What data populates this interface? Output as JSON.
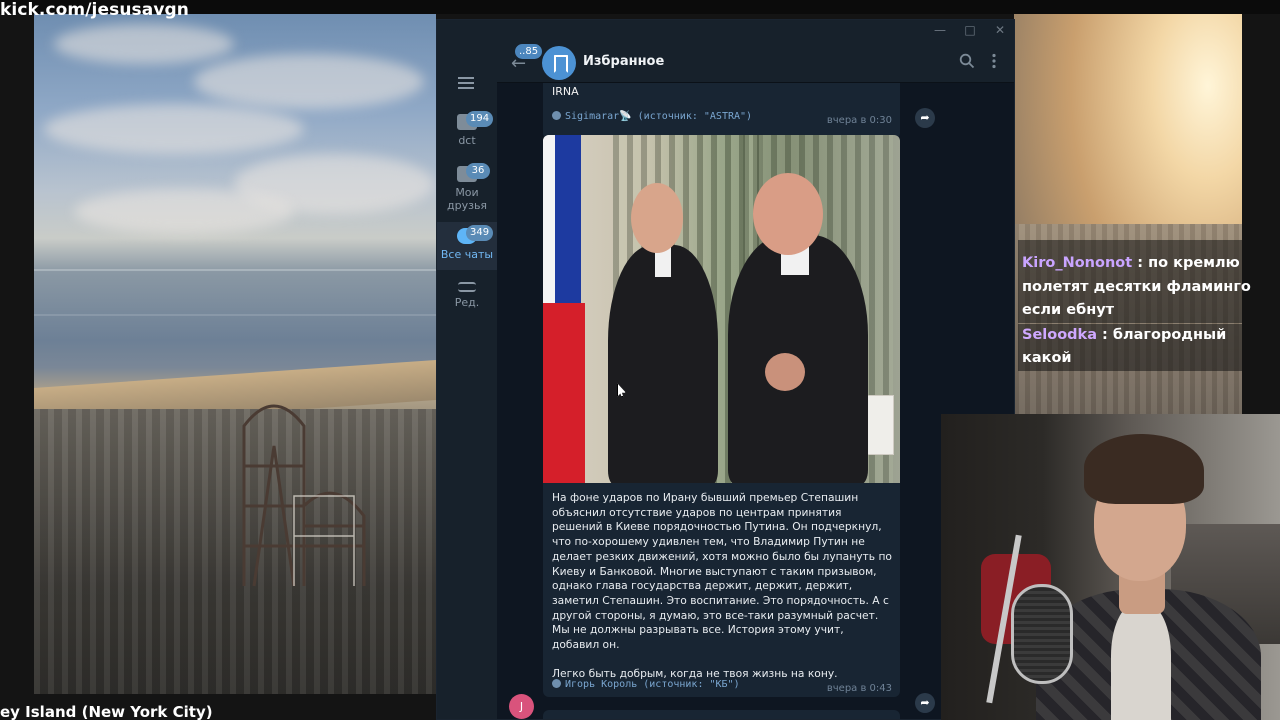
{
  "stream": {
    "url": "kick.com/jesusavgn",
    "background_caption": "ey Island (New York City)"
  },
  "window": {
    "controls": [
      "—",
      "□",
      "✕"
    ]
  },
  "folders": [
    {
      "label": "dct",
      "badge": "194",
      "active": false
    },
    {
      "label": "Мои друзья",
      "badge": "36",
      "active": false
    },
    {
      "label": "Все чаты",
      "badge": "349",
      "active": true
    },
    {
      "label": "Ред.",
      "badge": "",
      "active": false
    }
  ],
  "header": {
    "back_badge": "..85",
    "title": "Избранное"
  },
  "messages": [
    {
      "text": "IRNA",
      "signature": "Sigimarar📡 (источник: \"ASTRA\")",
      "time": "вчера в 0:30"
    },
    {
      "paragraphs": [
        "На фоне ударов по Ирану бывший премьер Степашин объяснил отсутствие ударов по центрам принятия решений в Киеве порядочностью Путина. Он подчеркнул, что по-хорошему удивлен тем, что Владимир Путин не делает резких движений, хотя можно было бы лупануть по Киеву и Банковой. Многие выступают с таким призывом, однако глава государства держит, держит, держит, заметил Степашин. Это воспитание. Это порядочность. А с другой стороны, я думаю, это все-таки разумный расчет. Мы не должны разрывать все. История этому учит, добавил он.",
        "Легко быть добрым, когда не твоя жизнь на кону."
      ],
      "signature": "Игорь Король (источник: \"КБ\")",
      "time": "вчера в 0:43",
      "avatar_letter": "J"
    }
  ],
  "chat_overlay": [
    {
      "user": "Kiro_Nononot",
      "text": ": по кремлю полетят десятки фламинго если ебнут"
    },
    {
      "user": "Seloodka",
      "text": ": благородный какой"
    }
  ],
  "colors": {
    "tg_bg": "#0e1621",
    "tg_panel": "#17212b",
    "bubble": "#182533",
    "accent": "#5eb5f7",
    "signature": "#7aa6d0",
    "chat_user": "#c9a4ff"
  }
}
